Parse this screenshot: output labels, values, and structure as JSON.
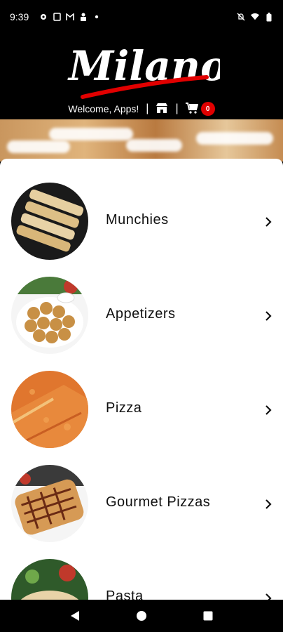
{
  "status_bar": {
    "time": "9:39",
    "left_icons": [
      "settings-icon",
      "sim-icon",
      "gmail-icon",
      "person-icon",
      "dot-icon"
    ],
    "right_icons": [
      "mute-icon",
      "wifi-icon",
      "battery-icon"
    ]
  },
  "header": {
    "logo_text": "Milano",
    "welcome": "Welcome, Apps!",
    "separator": "|",
    "cart_count": "0",
    "brand_color": "#e10000"
  },
  "menu": {
    "items": [
      {
        "label": "Munchies",
        "icon": "chevron-right-icon"
      },
      {
        "label": "Appetizers",
        "icon": "chevron-right-icon"
      },
      {
        "label": "Pizza",
        "icon": "chevron-right-icon"
      },
      {
        "label": "Gourmet Pizzas",
        "icon": "chevron-right-icon"
      },
      {
        "label": "Pasta",
        "icon": "chevron-right-icon"
      }
    ]
  },
  "nav_bar": {
    "buttons": [
      "back-icon",
      "home-icon",
      "recents-icon"
    ]
  }
}
